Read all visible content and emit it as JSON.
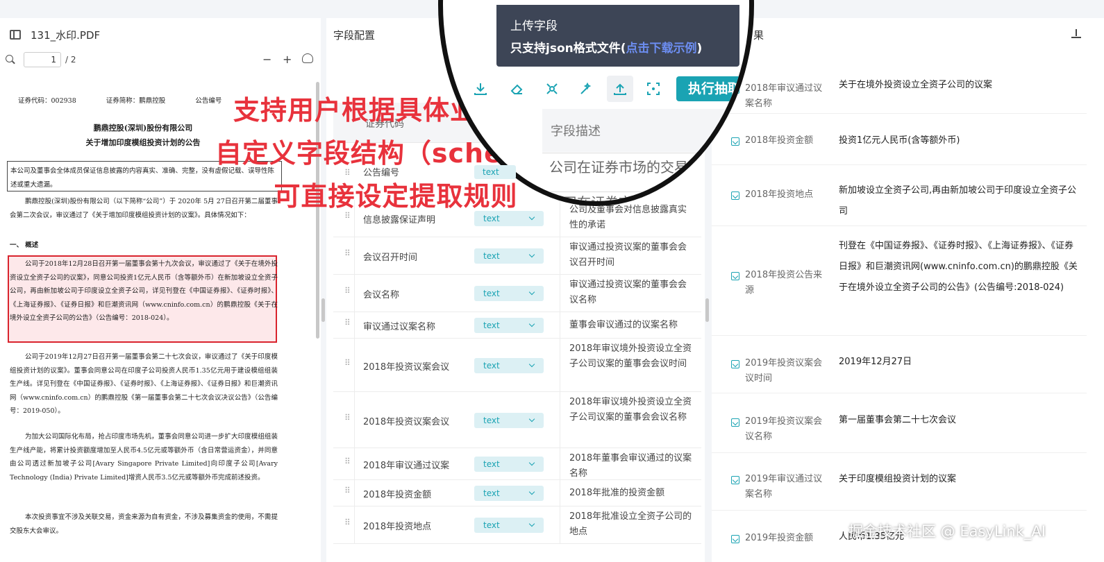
{
  "pdf": {
    "filename": "131_水印.PDF",
    "page_current": "1",
    "page_total": "/ 2",
    "zoom_out": "−",
    "zoom_in": "+",
    "doc": {
      "meta_code": "证券代码：002938",
      "meta_short": "证券简称：鹏鼎控股",
      "meta_no": "公告编号",
      "title1": "鹏鼎控股(深圳)股份有限公司",
      "title2": "关于增加印度模组投资计划的公告",
      "notice": "本公司及董事会全体成员保证信息披露的内容真实、准确、完整，没有虚假记载、误导性陈述或重大遗漏。",
      "p1": "鹏鼎控股(深圳)股份有限公司（以下简称“公司”）于 2020年 5月 27日召开第二届董事会第二次会议，审议通过了《关于增加印度模组投资计划的议案》。具体情况如下：",
      "h1": "一、    概述",
      "p2": "公司于2018年12月28日召开第一届董事会第十九次会议，审议通过了《关于在境外投资设立全资子公司的议案》，同意公司投资1亿元人民币（含等额外币）在新加坡设立全资子公司，再由新加坡公司于印度设立全资子公司，详见刊登在《中国证券报》、《证券时报》、《上海证券报》、《证券日报》和巨潮资讯网（www.cninfo.com.cn）的鹏鼎控股《关于在境外设立全资子公司的公告》（公告编号：2018-024）。",
      "p3": "公司于2019年12月27日召开第一届董事会第二十七次会议，审议通过了《关于印度模组投资计划的议案》。董事会同意公司在印度子公司投资人民币1.35亿元用于建设模组组装生产线。详见刊登在《中国证券报》、《证券时报》、《上海证券报》、《证券日报》和巨潮资讯网（www.cninfo.com.cn）的鹏鼎控股《第一届董事会第二十七次会议决议公告》（公告编号：2019-050）。",
      "p4": "为加大公司国际化布局，抢占印度市场先机，董事会同意公司进一步扩大印度模组组装生产线产能，将累计投资额度增加至人民币4.5亿元或等额外币（含日常营运资金），并同意由公司透过新加坡子公司[Avary Singapore Private Limited]向印度子公司[Avary Technology (India) Private Limited]增资人民币3.5亿元或等额外币完成前述投资。",
      "p5": "本次投资事宜不涉及关联交易，资金来源为自有资金，不涉及募集资金的使用，不需提交股东大会审议。"
    }
  },
  "caption": {
    "line1": "支持用户根据具体业务需求",
    "line2": "自定义字段结构（schema）",
    "line3": "可直接设定提取规则"
  },
  "mid": {
    "title": "字段配置",
    "col_name": "证券代码",
    "col_desc": "字段描述",
    "tooltip_title": "上传字段",
    "tooltip_text": "只支持json格式文件(",
    "tooltip_link": "点击下载示例",
    "tooltip_end": ")",
    "run_label": "执行抽取",
    "lens_row1_name": "公告编号",
    "lens_row1_type": "text",
    "lens_row1_desc": "公司在证券市场的交易代",
    "lens_row2_desc": "公司在证券市场",
    "rows": [
      {
        "name": "信息披露保证声明",
        "type": "text",
        "desc": "公司及董事会对信息披露真实性的承诺"
      },
      {
        "name": "会议召开时间",
        "type": "text",
        "desc": "审议通过投资议案的董事会会议召开时间"
      },
      {
        "name": "会议名称",
        "type": "text",
        "desc": "审议通过投资议案的董事会会议名称"
      },
      {
        "name": "审议通过议案名称",
        "type": "text",
        "desc": "董事会审议通过的议案名称"
      },
      {
        "name": "2018年投资议案会议",
        "type": "text",
        "desc": "2018年审议境外投资设立全资子公司议案的董事会会议时间"
      },
      {
        "name": "2018年投资议案会议",
        "type": "text",
        "desc": "2018年审议境外投资设立全资子公司议案的董事会会议名称"
      },
      {
        "name": "2018年审议通过议案",
        "type": "text",
        "desc": "2018年董事会审议通过的议案名称"
      },
      {
        "name": "2018年投资金额",
        "type": "text",
        "desc": "2018年批准的投资金额"
      },
      {
        "name": "2018年投资地点",
        "type": "text",
        "desc": "2018年批准设立全资子公司的地点"
      }
    ]
  },
  "right": {
    "title": "果",
    "results": [
      {
        "key": "2018年审议通过议案名称",
        "value": "关于在境外投资设立全资子公司的议案"
      },
      {
        "key": "2018年投资金额",
        "value": "投资1亿元人民币(含等额外币)"
      },
      {
        "key": "2018年投资地点",
        "value": "新加坡设立全资子公司,再由新加坡公司于印度设立全资子公司"
      },
      {
        "key": "2018年投资公告来源",
        "value": "刊登在《中国证券报》、《证券时报》、《上海证券报》、《证券日报》和巨潮资讯网(www.cninfo.com.cn)的鹏鼎控股《关于在境外设立全资子公司的公告》(公告编号:2018-024)"
      },
      {
        "key": "2019年投资议案会议时间",
        "value": "2019年12月27日"
      },
      {
        "key": "2019年投资议案会议名称",
        "value": "第一届董事会第二十七次会议"
      },
      {
        "key": "2019年审议通过议案名称",
        "value": "关于印度模组投资计划的议案"
      },
      {
        "key": "2019年投资金额",
        "value": "人民币1.35亿元"
      }
    ]
  },
  "watermark": "掘金技术社区 @ EasyLink_AI",
  "colors": {
    "accent": "#1aa3b3",
    "highlight": "#d9232d",
    "caption": "#e8323c",
    "tooltip_bg": "#3d4556"
  }
}
